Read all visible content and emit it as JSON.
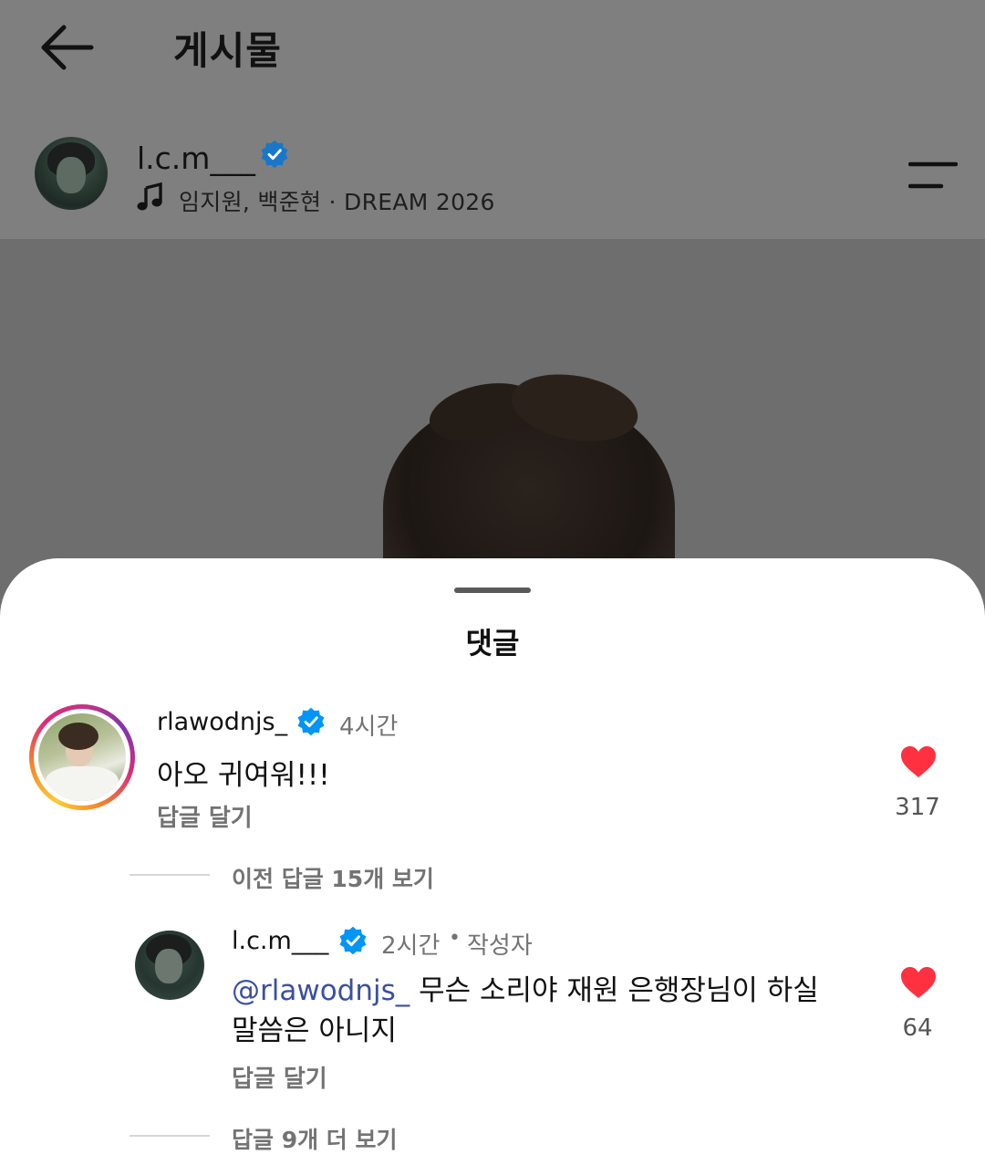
{
  "header": {
    "title": "게시물"
  },
  "post": {
    "username": "l.c.m___",
    "music": "임지원, 백준현 · DREAM 2026"
  },
  "comments_sheet": {
    "title": "댓글",
    "comment": {
      "username": "rlawodnjs_",
      "time": "4시간",
      "text": "아오 귀여워!!!",
      "reply_label": "답글 달기",
      "likes": "317"
    },
    "view_previous": "이전 답글 15개 보기",
    "reply": {
      "username": "l.c.m___",
      "time": "2시간",
      "separator": "•",
      "author_label": "작성자",
      "mention": "@rlawodnjs_",
      "text": " 무슨 소리야 재원 은행장님이 하실 말씀은 아니지",
      "reply_label": "답글 달기",
      "likes": "64"
    },
    "view_more": "답글 9개 더 보기"
  },
  "colors": {
    "verified": "#0095f6",
    "like": "#ff3040",
    "mention": "#3b4fa3",
    "muted": "#737373"
  },
  "icons": [
    "back-arrow-icon",
    "verified-badge-icon",
    "music-note-icon",
    "menu-icon",
    "heart-icon"
  ]
}
